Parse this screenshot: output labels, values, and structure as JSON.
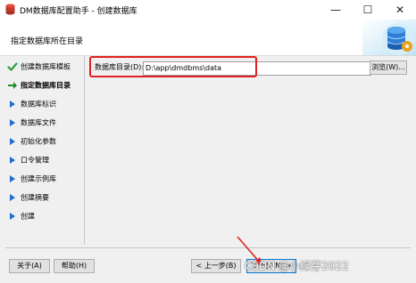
{
  "window": {
    "title": "DM数据库配置助手 - 创建数据库",
    "minimize_glyph": "—",
    "maximize_glyph": "☐",
    "close_glyph": "✕"
  },
  "banner": {
    "heading": "指定数据库所在目录"
  },
  "sidebar": {
    "items": [
      {
        "label": "创建数据库模板",
        "icon": "check-icon",
        "state": "done"
      },
      {
        "label": "指定数据库目录",
        "icon": "arrow-right-icon",
        "state": "current"
      },
      {
        "label": "数据库标识",
        "icon": "triangle-bullet-icon",
        "state": "pending"
      },
      {
        "label": "数据库文件",
        "icon": "triangle-bullet-icon",
        "state": "pending"
      },
      {
        "label": "初始化参数",
        "icon": "triangle-bullet-icon",
        "state": "pending"
      },
      {
        "label": "口令管理",
        "icon": "triangle-bullet-icon",
        "state": "pending"
      },
      {
        "label": "创建示例库",
        "icon": "triangle-bullet-icon",
        "state": "pending"
      },
      {
        "label": "创建摘要",
        "icon": "triangle-bullet-icon",
        "state": "pending"
      },
      {
        "label": "创建",
        "icon": "triangle-bullet-icon",
        "state": "pending"
      }
    ]
  },
  "form": {
    "dir_label": "数据库目录(D):",
    "dir_value": "D:\\app\\dmdbms\\data",
    "browse_label": "浏览(W)..."
  },
  "footer": {
    "about_label": "关于(A)",
    "help_label": "帮助(H)",
    "prev_label": "< 上一步(B)",
    "next_label": "下一步(N) >",
    "watermark": "CSDN @小绿芽2022"
  },
  "colors": {
    "check": "#2e9e3e",
    "arrow": "#1f8a2e",
    "bullet": "#1e6fd0",
    "highlight": "#e02020"
  }
}
